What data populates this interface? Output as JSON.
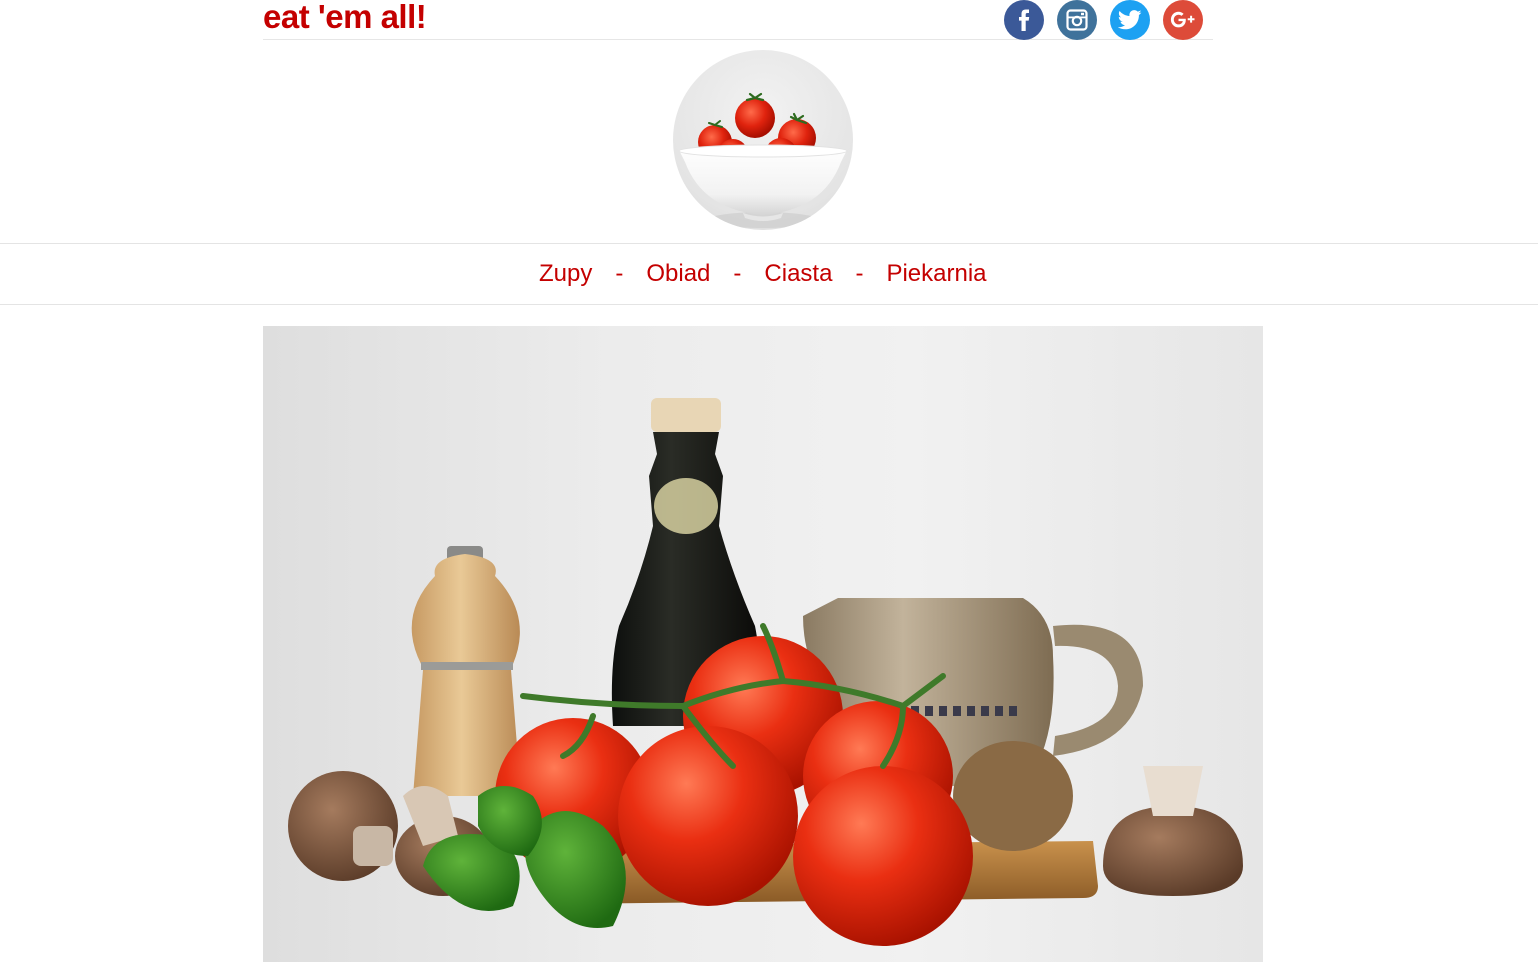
{
  "header": {
    "brand": "eat 'em all!"
  },
  "social_icons": [
    {
      "name": "facebook-icon",
      "color": "#3b5998"
    },
    {
      "name": "instagram-icon",
      "color": "#3f729b"
    },
    {
      "name": "twitter-icon",
      "color": "#1da1f2"
    },
    {
      "name": "google-plus-icon",
      "color": "#dd4b39"
    }
  ],
  "nav": {
    "items": [
      {
        "label": "Zupy"
      },
      {
        "label": "Obiad"
      },
      {
        "label": "Ciasta"
      },
      {
        "label": "Piekarnia"
      }
    ],
    "separator": "-"
  },
  "colors": {
    "accent": "#c40000"
  }
}
